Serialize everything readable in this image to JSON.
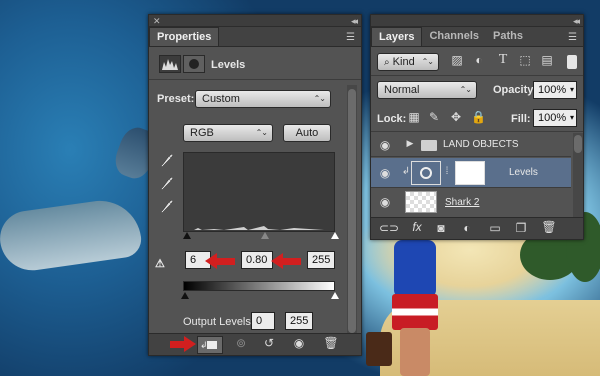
{
  "properties_panel": {
    "tab": "Properties",
    "adjustment_title": "Levels",
    "preset_label": "Preset:",
    "preset_value": "Custom",
    "channel_value": "RGB",
    "auto_label": "Auto",
    "input_black": "6",
    "input_gamma": "0.80",
    "input_white": "255",
    "output_label": "Output Levels:",
    "output_black": "0",
    "output_white": "255"
  },
  "layers_panel": {
    "tabs": [
      "Layers",
      "Channels",
      "Paths"
    ],
    "kind_label": "Kind",
    "blend_mode": "Normal",
    "opacity_label": "Opacity:",
    "opacity_value": "100%",
    "lock_label": "Lock:",
    "fill_label": "Fill:",
    "fill_value": "100%",
    "layers": [
      {
        "name": "LAND OBJECTS",
        "type": "group"
      },
      {
        "name": "Levels",
        "type": "adjustment"
      },
      {
        "name": "Shark 2",
        "type": "pixel"
      }
    ]
  },
  "colors": {
    "panel_bg": "#535353",
    "selected_row": "#5a6f8c",
    "annotation_red": "#d21f1f"
  }
}
